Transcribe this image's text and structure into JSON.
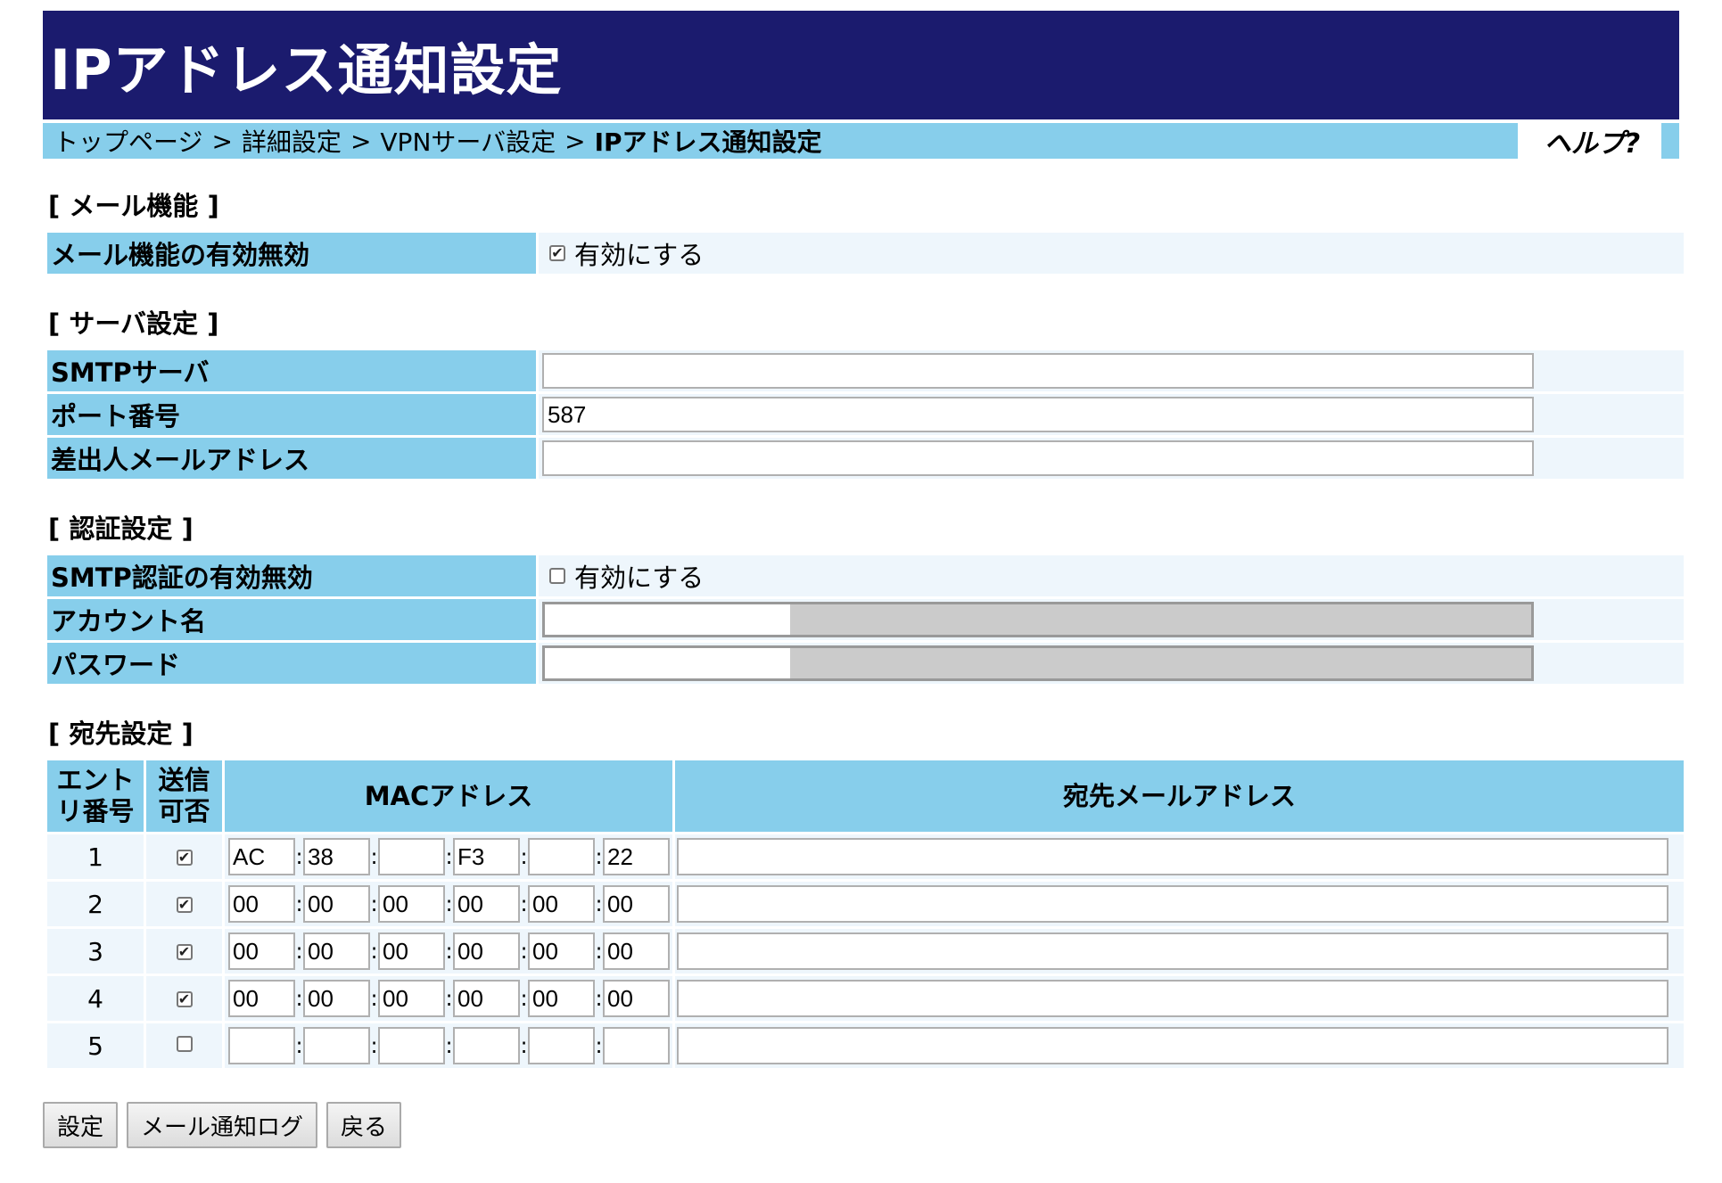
{
  "title": "IPアドレス通知設定",
  "breadcrumb": {
    "items": [
      "トップページ",
      "詳細設定",
      "VPNサーバ設定"
    ],
    "current": "IPアドレス通知設定",
    "separator": ">"
  },
  "help_label": "ヘルプ?",
  "mail_section": {
    "heading": "[ メール機能 ]",
    "enable_label": "メール機能の有効無効",
    "enable_checkbox_label": "有効にする",
    "enabled": true
  },
  "server_section": {
    "heading": "[ サーバ設定 ]",
    "smtp_label": "SMTPサーバ",
    "smtp_value": "",
    "port_label": "ポート番号",
    "port_value": "587",
    "sender_label": "差出人メールアドレス",
    "sender_value": ""
  },
  "auth_section": {
    "heading": "[ 認証設定 ]",
    "enable_label": "SMTP認証の有効無効",
    "enable_checkbox_label": "有効にする",
    "enabled": false,
    "account_label": "アカウント名",
    "password_label": "パスワード"
  },
  "dest_section": {
    "heading": "[ 宛先設定 ]",
    "col_entry": "エントリ番号",
    "col_entry_line1": "エント",
    "col_entry_line2": "リ番号",
    "col_send_line1": "送信",
    "col_send_line2": "可否",
    "col_mac": "MACアドレス",
    "col_mail": "宛先メールアドレス",
    "rows": [
      {
        "no": "1",
        "send": true,
        "mac": [
          "AC",
          "38",
          "",
          "F3",
          "",
          "22"
        ],
        "mail": ""
      },
      {
        "no": "2",
        "send": true,
        "mac": [
          "00",
          "00",
          "00",
          "00",
          "00",
          "00"
        ],
        "mail": ""
      },
      {
        "no": "3",
        "send": true,
        "mac": [
          "00",
          "00",
          "00",
          "00",
          "00",
          "00"
        ],
        "mail": ""
      },
      {
        "no": "4",
        "send": true,
        "mac": [
          "00",
          "00",
          "00",
          "00",
          "00",
          "00"
        ],
        "mail": ""
      },
      {
        "no": "5",
        "send": false,
        "mac": [
          "",
          "",
          "",
          "",
          "",
          ""
        ],
        "mail": ""
      }
    ]
  },
  "buttons": {
    "save": "設定",
    "log": "メール通知ログ",
    "back": "戻る"
  },
  "colors": {
    "title_bg": "#1b1b6e",
    "label_bg": "#87ceeb",
    "value_bg": "#eef6fc"
  }
}
